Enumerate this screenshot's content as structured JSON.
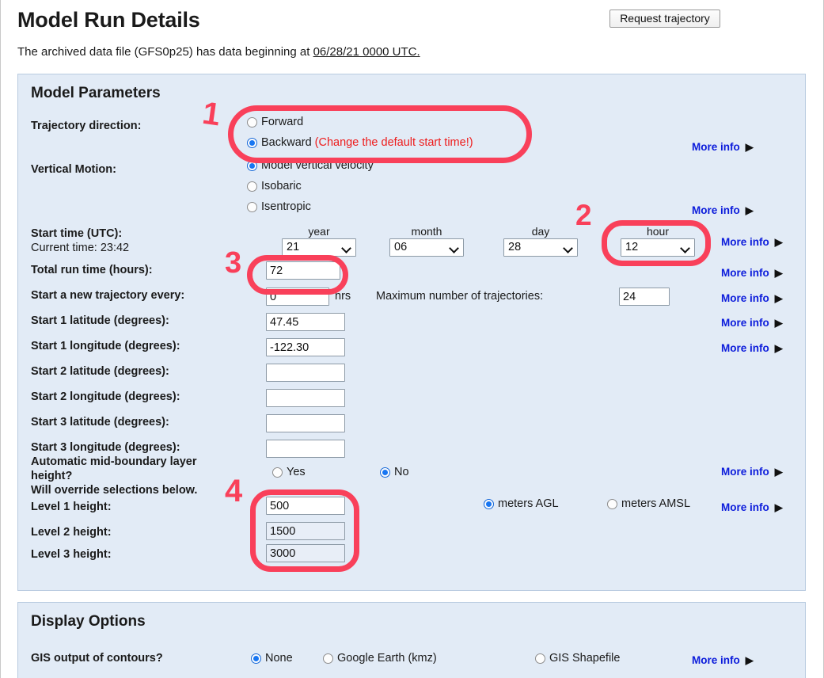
{
  "page": {
    "title": "Model Run Details",
    "request_button": "Request trajectory",
    "archive_prefix": "The archived data file (GFS0p25) has data beginning at ",
    "archive_date": "06/28/21 0000 UTC."
  },
  "model_parameters": {
    "heading": "Model Parameters",
    "trajectory_direction": {
      "label": "Trajectory direction:",
      "options": [
        "Forward",
        "Backward"
      ],
      "selected": "Backward",
      "note": "(Change the default start time!)"
    },
    "vertical_motion": {
      "label": "Vertical Motion:",
      "options": [
        "Model vertical velocity",
        "Isobaric",
        "Isentropic"
      ],
      "selected": "Model vertical velocity"
    },
    "start_time": {
      "label": "Start time (UTC):",
      "current_time": "Current time: 23:42",
      "columns": [
        "year",
        "month",
        "day",
        "hour"
      ],
      "year": "21",
      "month": "06",
      "day": "28",
      "hour": "12"
    },
    "total_run_time": {
      "label": "Total run time (hours):",
      "value": "72"
    },
    "new_trajectory_every": {
      "label": "Start a new trajectory every:",
      "value": "0",
      "unit": "hrs"
    },
    "max_trajectories": {
      "label": "Maximum number of trajectories:",
      "value": "24"
    },
    "start1_lat": {
      "label": "Start 1 latitude (degrees):",
      "value": "47.45"
    },
    "start1_lon": {
      "label": "Start 1 longitude (degrees):",
      "value": "-122.30"
    },
    "start2_lat": {
      "label": "Start 2 latitude (degrees):",
      "value": ""
    },
    "start2_lon": {
      "label": "Start 2 longitude (degrees):",
      "value": ""
    },
    "start3_lat": {
      "label": "Start 3 latitude (degrees):",
      "value": ""
    },
    "start3_lon": {
      "label": "Start 3 longitude (degrees):",
      "value": ""
    },
    "auto_midboundary": {
      "label_line1": "Automatic mid-boundary layer",
      "label_line2": "height?",
      "label_line3": "Will override selections below.",
      "options": [
        "Yes",
        "No"
      ],
      "selected": "No"
    },
    "level1": {
      "label": "Level 1 height:",
      "value": "500"
    },
    "level2": {
      "label": "Level 2 height:",
      "value": "1500"
    },
    "level3": {
      "label": "Level 3 height:",
      "value": "3000"
    },
    "height_units": {
      "options": [
        "meters AGL",
        "meters AMSL"
      ],
      "selected": "meters AGL"
    },
    "more_info_label": "More info"
  },
  "display_options": {
    "heading": "Display Options",
    "gis_output": {
      "label": "GIS output of contours?",
      "options": [
        "None",
        "Google Earth (kmz)",
        "GIS Shapefile"
      ],
      "selected": "None"
    },
    "more_info_label": "More info"
  },
  "annotations": {
    "color": "#f9405a",
    "marks": [
      "1",
      "2",
      "3",
      "4"
    ]
  }
}
